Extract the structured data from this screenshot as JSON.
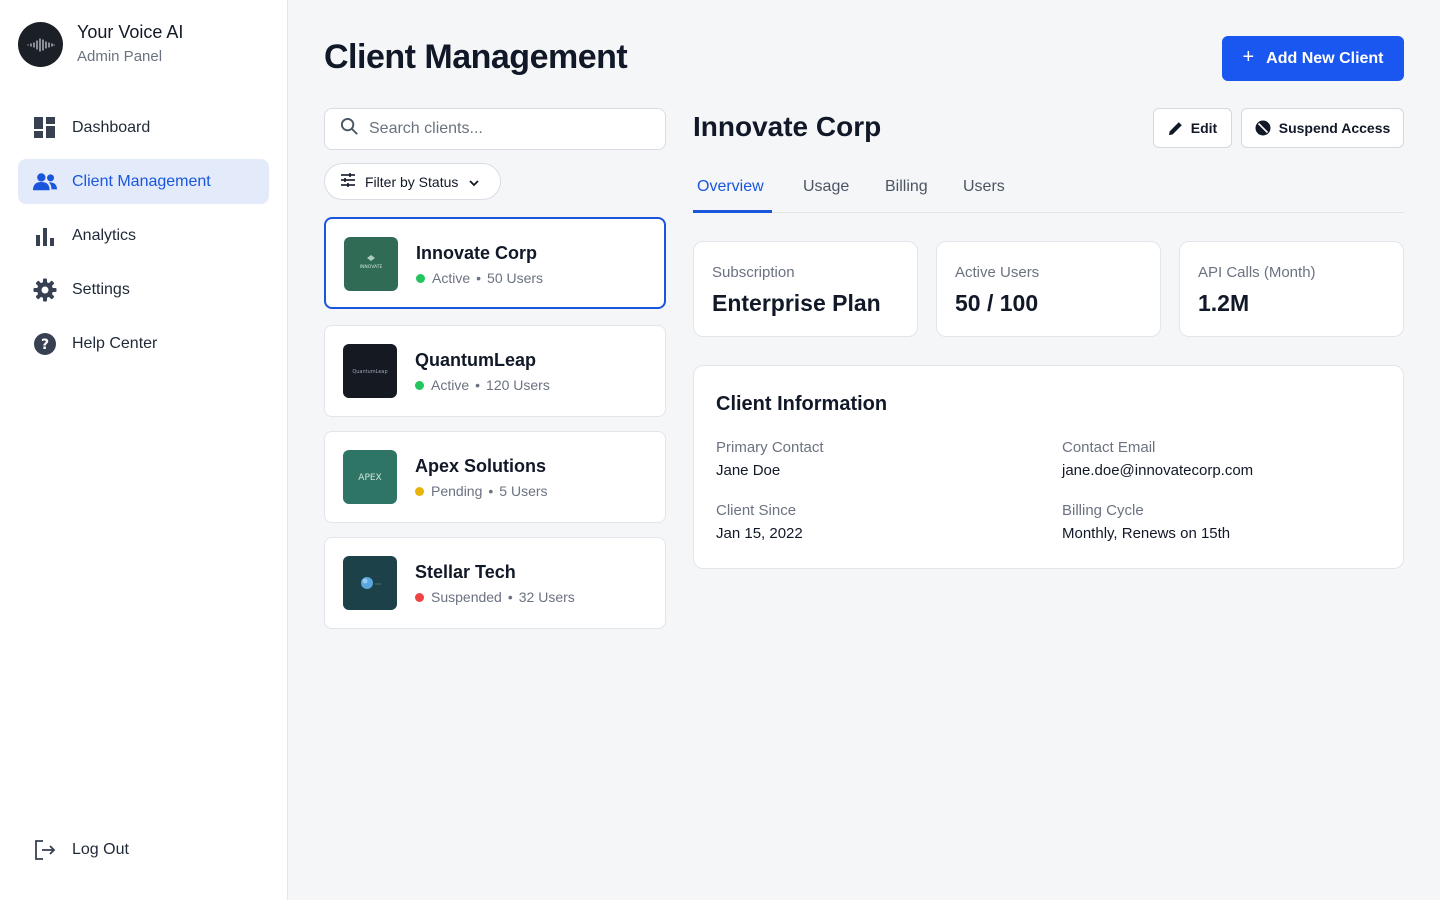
{
  "brand": {
    "title": "Your Voice AI",
    "subtitle": "Admin Panel",
    "logo": "voice-waveform-icon"
  },
  "sidebar": {
    "items": [
      {
        "label": "Dashboard",
        "icon": "dashboard-icon",
        "active": false
      },
      {
        "label": "Client Management",
        "icon": "users-icon",
        "active": true
      },
      {
        "label": "Analytics",
        "icon": "bar-chart-icon",
        "active": false
      },
      {
        "label": "Settings",
        "icon": "gear-icon",
        "active": false
      },
      {
        "label": "Help Center",
        "icon": "help-icon",
        "active": false
      }
    ],
    "logout_label": "Log Out"
  },
  "header": {
    "title": "Client Management",
    "add_button_label": "Add New Client"
  },
  "search": {
    "placeholder": "Search clients...",
    "value": ""
  },
  "filter": {
    "label": "Filter by Status"
  },
  "clients": [
    {
      "name": "Innovate Corp",
      "status": "Active",
      "users": "50 Users",
      "status_color": "#22c55e",
      "selected": true,
      "thumb_bg": "#2f6b55",
      "thumb_text": "INNOVATE"
    },
    {
      "name": "QuantumLeap",
      "status": "Active",
      "users": "120 Users",
      "status_color": "#22c55e",
      "selected": false,
      "thumb_bg": "#151a22",
      "thumb_text": "QuantumLeap"
    },
    {
      "name": "Apex Solutions",
      "status": "Pending",
      "users": "5 Users",
      "status_color": "#eab308",
      "selected": false,
      "thumb_bg": "#2e7566",
      "thumb_text": "APEX"
    },
    {
      "name": "Stellar Tech",
      "status": "Suspended",
      "users": "32 Users",
      "status_color": "#ef4444",
      "selected": false,
      "thumb_bg": "#1c4149",
      "thumb_text": ""
    }
  ],
  "detail": {
    "title": "Innovate Corp",
    "edit_label": "Edit",
    "suspend_label": "Suspend Access",
    "tabs": [
      "Overview",
      "Usage",
      "Billing",
      "Users"
    ],
    "active_tab": "Overview",
    "stats": [
      {
        "label": "Subscription",
        "value": "Enterprise Plan"
      },
      {
        "label": "Active Users",
        "value": "50 / 100"
      },
      {
        "label": "API Calls (Month)",
        "value": "1.2M"
      }
    ],
    "info": {
      "title": "Client Information",
      "primary_contact_label": "Primary Contact",
      "primary_contact": "Jane Doe",
      "email_label": "Contact Email",
      "email": "jane.doe@innovatecorp.com",
      "since_label": "Client Since",
      "since": "Jan 15, 2022",
      "billing_label": "Billing Cycle",
      "billing": "Monthly, Renews on 15th"
    }
  },
  "colors": {
    "accent": "#1a56db",
    "button": "#1a56f0",
    "active_nav_bg": "#e3ebfb"
  }
}
